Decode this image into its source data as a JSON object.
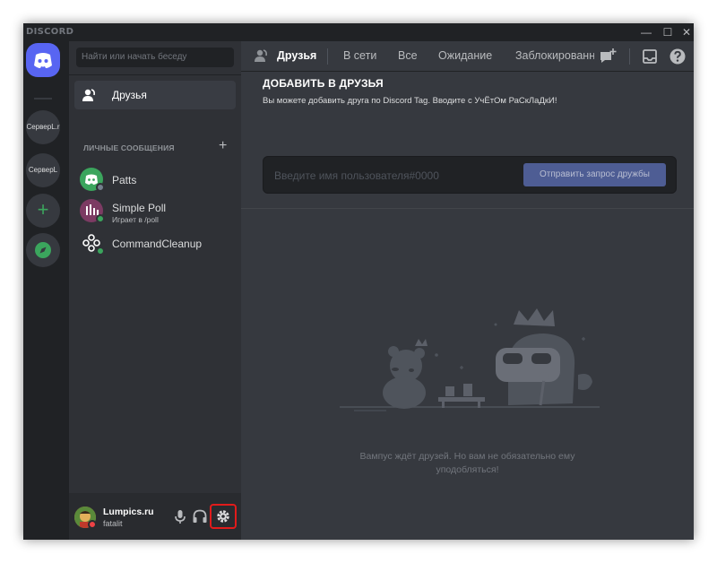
{
  "window": {
    "wordmark": "DISCORD",
    "minimize_glyph": "—",
    "maximize_glyph": "☐",
    "close_glyph": "✕"
  },
  "servers": [
    {
      "id": "home",
      "icon": "discord-logo-icon"
    },
    {
      "label": "СерверL.r"
    },
    {
      "label": "СерверL"
    },
    {
      "icon": "plus-icon",
      "glyph": "+"
    },
    {
      "icon": "compass-icon"
    }
  ],
  "sidebar": {
    "search_placeholder": "Найти или начать беседу",
    "friends_label": "Друзья",
    "dm_header": "ЛИЧНЫЕ СООБЩЕНИЯ",
    "dm_add_glyph": "+",
    "dms": [
      {
        "name": "Patts",
        "status_color": "#747f8d",
        "avatar_color": "#3ba55d"
      },
      {
        "name": "Simple Poll",
        "subtitle": "Играет в /poll",
        "status_color": "#3ba55d",
        "avatar_color": "#7c3b63"
      },
      {
        "name": "CommandCleanup",
        "status_color": "#3ba55d",
        "avatar_color": "#2f3136"
      }
    ]
  },
  "user": {
    "name": "Lumpics.ru",
    "tag": "fatalit",
    "status_color": "#ed4245"
  },
  "topbar": {
    "title": "Друзья",
    "tabs": [
      "В сети",
      "Все",
      "Ожидание",
      "Заблокированные"
    ]
  },
  "add_friend": {
    "title": "ДОБАВИТЬ В ДРУЗЬЯ",
    "description": "Вы можете добавить друга по Discord Tag. Вводите с УчЁтОм РаСкЛаДкИ!",
    "input_placeholder": "Введите имя пользователя#0000",
    "button_label": "Отправить запрос дружбы"
  },
  "empty_state": {
    "text": "Вампус ждёт друзей. Но вам не обязательно ему уподобляться!"
  },
  "colors": {
    "blurple": "#5865f2",
    "green": "#3ba55d",
    "highlight_red": "#e11b1b"
  }
}
